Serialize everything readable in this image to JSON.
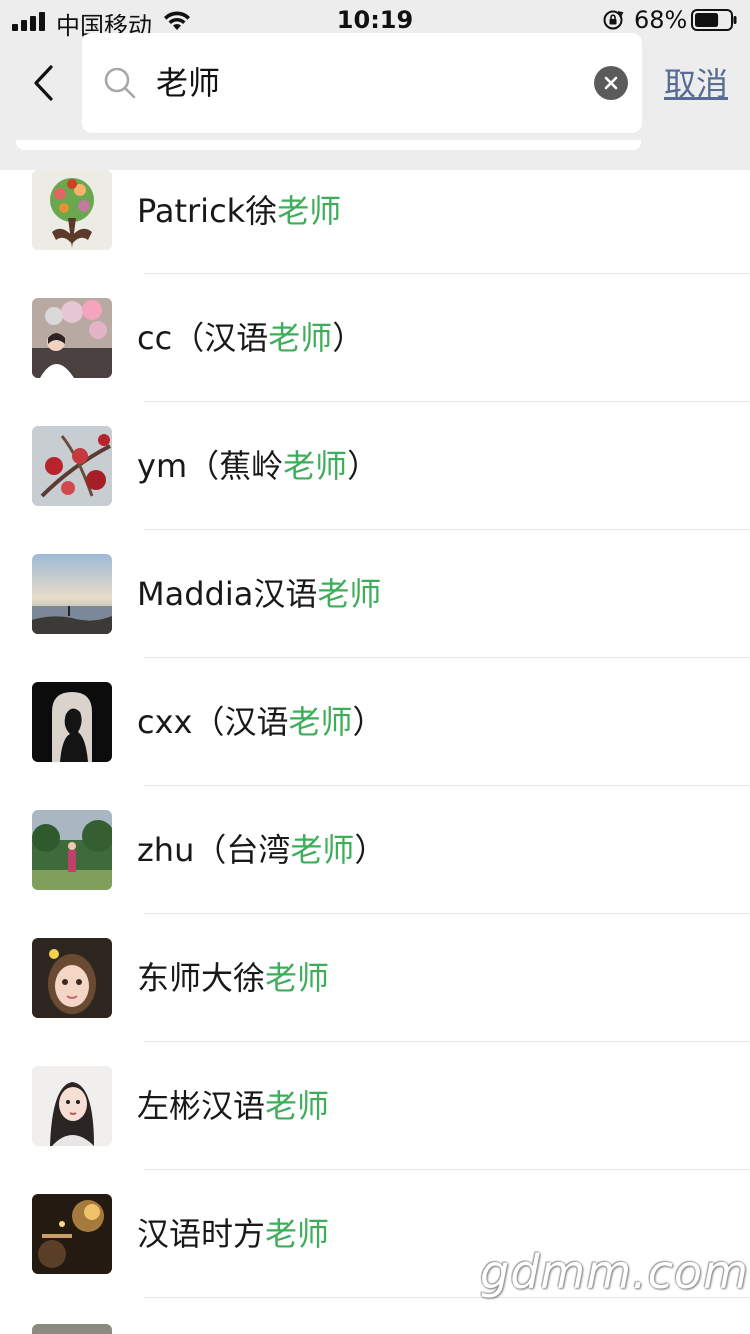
{
  "status_bar": {
    "carrier": "中国移动",
    "time": "10:19",
    "battery_percent": "68%",
    "battery_level": 0.68,
    "icons": [
      "signal-icon",
      "wifi-icon",
      "rotation-lock-icon",
      "battery-icon"
    ]
  },
  "search": {
    "query": "老师",
    "cancel_label": "取消",
    "icons": [
      "back-icon",
      "search-icon",
      "clear-icon"
    ]
  },
  "results": [
    {
      "prefix": "Patrick徐",
      "highlight": "老师",
      "suffix": "",
      "avatar": "tree-hands-avatar"
    },
    {
      "prefix": "cc（汉语",
      "highlight": "老师",
      "suffix": "）",
      "avatar": "balloons-photo-avatar"
    },
    {
      "prefix": "ym（蕉岭",
      "highlight": "老师",
      "suffix": "）",
      "avatar": "red-flowers-avatar"
    },
    {
      "prefix": "Maddia汉语",
      "highlight": "老师",
      "suffix": "",
      "avatar": "seaside-sunset-avatar"
    },
    {
      "prefix": "cxx（汉语",
      "highlight": "老师",
      "suffix": "）",
      "avatar": "silhouette-avatar"
    },
    {
      "prefix": "zhu（台湾",
      "highlight": "老师",
      "suffix": "）",
      "avatar": "park-photo-avatar"
    },
    {
      "prefix": "东师大徐",
      "highlight": "老师",
      "suffix": "",
      "avatar": "child-portrait-avatar"
    },
    {
      "prefix": "左彬汉语",
      "highlight": "老师",
      "suffix": "",
      "avatar": "woman-portrait-avatar"
    },
    {
      "prefix": "汉语时方",
      "highlight": "老师",
      "suffix": "",
      "avatar": "candlelight-avatar"
    }
  ],
  "colors": {
    "header_bg": "#ededed",
    "highlight_green": "#3fae5a",
    "link_blue": "#576b95",
    "text": "#191919"
  },
  "watermark": "gdmm.com"
}
